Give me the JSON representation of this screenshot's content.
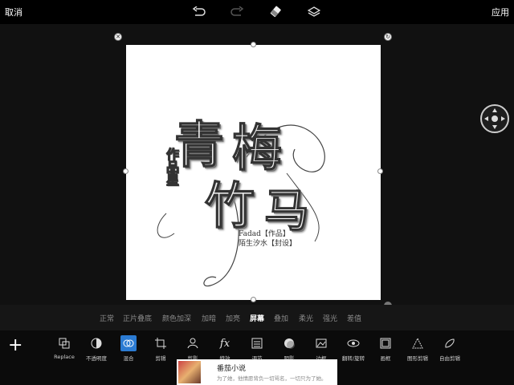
{
  "topbar": {
    "cancel": "取消",
    "apply": "应用"
  },
  "artwork": {
    "line1a": "青",
    "line1b": "梅",
    "line2a": "竹",
    "line2b": "马",
    "side": "作品星",
    "credit1": "Fadad【作品】",
    "credit2": "陌生汐水【封设】"
  },
  "blend_modes": [
    "正常",
    "正片叠底",
    "颜色加深",
    "加暗",
    "加亮",
    "屏幕",
    "叠加",
    "柔光",
    "强光",
    "差值"
  ],
  "blend_active": "屏幕",
  "tools": [
    {
      "label": "Replace",
      "icon": "replace-icon"
    },
    {
      "label": "不透明度",
      "icon": "opacity-icon"
    },
    {
      "label": "混合",
      "icon": "blend-icon"
    },
    {
      "label": "剪辑",
      "icon": "crop-icon"
    },
    {
      "label": "剪影",
      "icon": "silhouette-icon"
    },
    {
      "label": "特效",
      "icon": "fx-icon"
    },
    {
      "label": "调节",
      "icon": "adjust-icon"
    },
    {
      "label": "阴影",
      "icon": "shadow-icon"
    },
    {
      "label": "边框",
      "icon": "border-icon"
    },
    {
      "label": "翻转/旋转",
      "icon": "flip-rotate-icon"
    },
    {
      "label": "画框",
      "icon": "frame-icon"
    },
    {
      "label": "图形剪辑",
      "icon": "shape-crop-icon"
    },
    {
      "label": "自由剪辑",
      "icon": "free-crop-icon"
    }
  ],
  "ad": {
    "title": "番茄小说",
    "subtitle": "为了她，他情愿背负一切骂名，一切只为了她。"
  }
}
